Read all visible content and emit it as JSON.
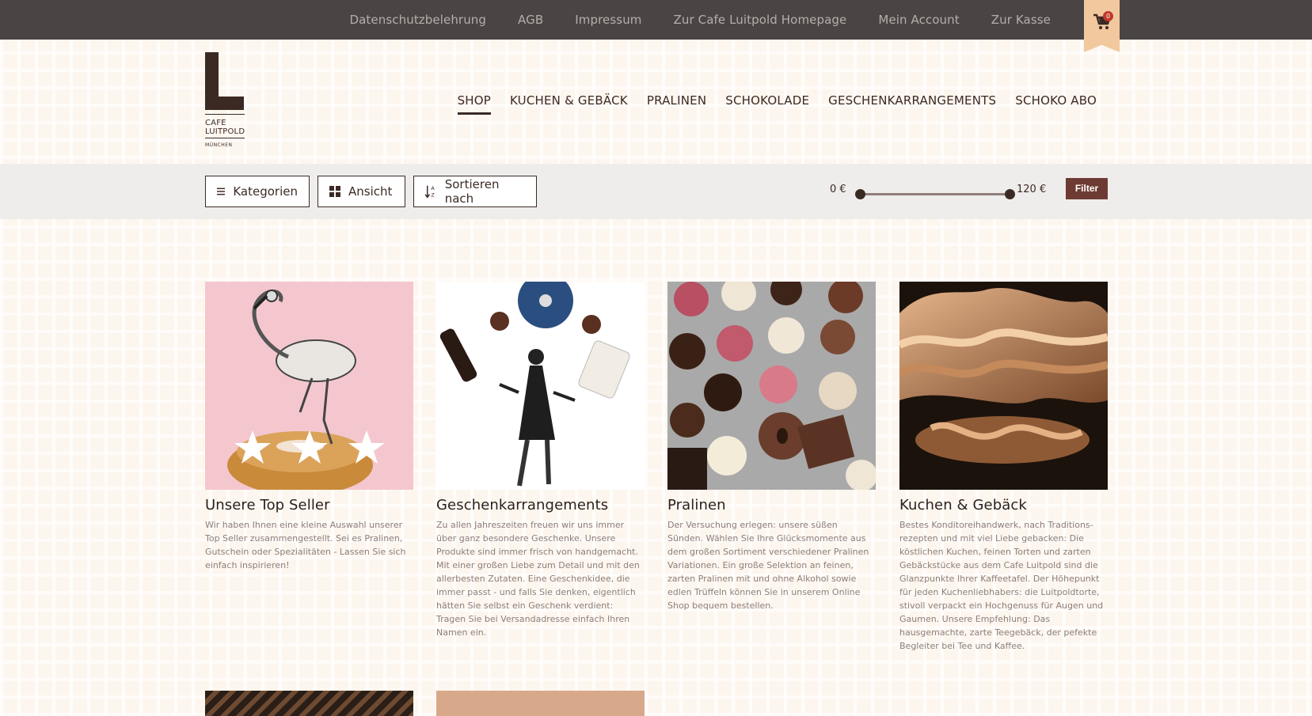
{
  "topbar": {
    "links": [
      "Datenschutzbelehrung",
      "AGB",
      "Impressum",
      "Zur Cafe Luitpold Homepage",
      "Mein Account",
      "Zur Kasse"
    ],
    "cart_count": "0"
  },
  "logo": {
    "line1": "CAFE",
    "line2": "LUITPOLD",
    "city": "MÜNCHEN"
  },
  "nav": {
    "items": [
      "SHOP",
      "KUCHEN & GEBÄCK",
      "PRALINEN",
      "SCHOKOLADE",
      "GESCHENKARRANGEMENTS",
      "SCHOKO ABO"
    ],
    "active": "SHOP"
  },
  "filterbar": {
    "kategorien": "Kategorien",
    "ansicht": "Ansicht",
    "sortieren": "Sortieren nach",
    "price_min": "0 €",
    "price_max": "120 €",
    "price_range": [
      0,
      120
    ],
    "filter_label": "Filter"
  },
  "products": [
    {
      "title": "Unsere Top Seller",
      "text": "Wir haben Ihnen eine kleine Auswahl unserer Top Seller zusammengestellt. Sei es Pralinen, Gutschein oder Spezialitäten - Lassen Sie sich einfach inspirieren!"
    },
    {
      "title": "Geschenkarrangements",
      "text": "Zu allen Jahreszeiten freuen wir uns immer über ganz besondere Geschenke. Unsere Produkte sind immer frisch von handgemacht. Mit einer großen Liebe zum Detail und mit den allerbesten Zutaten. Eine Geschenkidee, die immer passt - und falls Sie denken, eigentlich hätten Sie selbst ein Geschenk verdient: Tragen Sie bei Versandadresse einfach Ihren Namen ein."
    },
    {
      "title": "Pralinen",
      "text": "Der Versuchung erlegen: unsere süßen Sünden. Wählen Sie Ihre Glücksmomente aus dem großen Sortiment verschiedener Pralinen Variationen. Ein große Selektion an feinen, zarten Pralinen mit und ohne Alkohol sowie edlen Trüffeln können Sie in unserem Online Shop bequem bestellen."
    },
    {
      "title": "Kuchen & Gebäck",
      "text": "Bestes Konditoreihandwerk, nach Traditions-rezepten und mit viel Liebe gebacken: Die köstlichen Kuchen, feinen Torten und zarten Gebäckstücke aus dem Cafe Luitpold sind die Glanzpunkte Ihrer Kaffeetafel. Der Höhepunkt für jeden Kuchenliebhabers: die Luitpoldtorte, stivoll verpackt ein Hochgenuss für Augen und Gaumen. Unsere Empfehlung: Das hausgemachte, zarte Teegebäck, der pefekte Begleiter bei Tee und Kaffee."
    }
  ],
  "colors": {
    "topbar": "#4a4544",
    "accent_brown": "#3b2a24",
    "filter_button": "#6d3b33",
    "cart_ribbon": "#f2c99e",
    "cart_badge": "#c0392b"
  },
  "icons": [
    "cart-icon",
    "hamburger-icon",
    "grid-icon",
    "sort-az-icon"
  ]
}
